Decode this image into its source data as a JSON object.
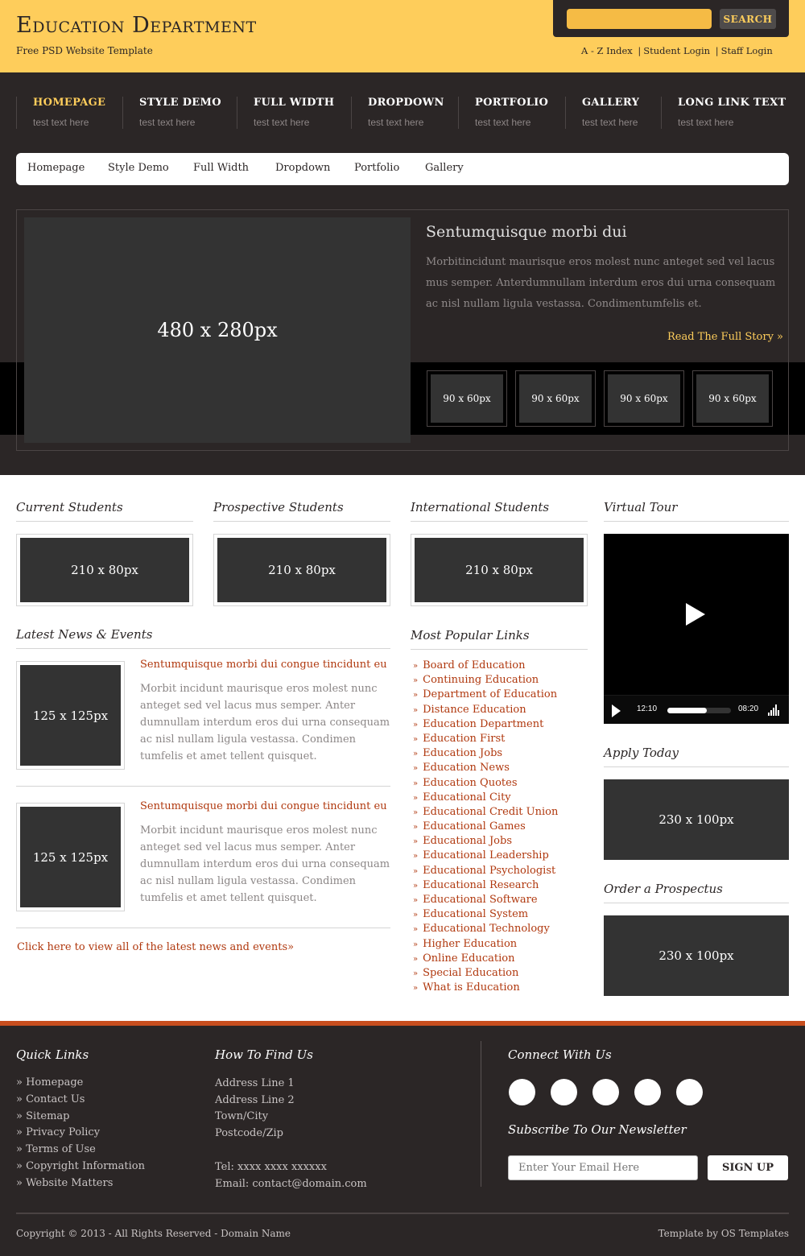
{
  "header": {
    "title": "Education Department",
    "tagline": "Free PSD Website Template",
    "search_button": "SEARCH",
    "links": [
      "A - Z Index",
      "Student Login",
      "Staff Login"
    ],
    "separator": "|"
  },
  "nav": [
    {
      "label": "HOMEPAGE",
      "sub": "test text here",
      "active": true
    },
    {
      "label": "STYLE DEMO",
      "sub": "test text here"
    },
    {
      "label": "FULL WIDTH",
      "sub": "test text here"
    },
    {
      "label": "DROPDOWN",
      "sub": "test text here"
    },
    {
      "label": "PORTFOLIO",
      "sub": "test text here"
    },
    {
      "label": "GALLERY",
      "sub": "test text here"
    },
    {
      "label": "LONG LINK TEXT",
      "sub": "test text here"
    }
  ],
  "subnav": [
    "Homepage",
    "Style Demo",
    "Full Width",
    "Dropdown",
    "Portfolio",
    "Gallery"
  ],
  "slider": {
    "main_image": "480 x 280px",
    "title": "Sentumquisque morbi dui",
    "text": "Morbitincidunt maurisque eros molest nunc anteget sed vel lacus mus semper. Anterdumnullam interdum eros dui urna consequam ac nisl nullam ligula vestassa. Condimentumfelis et.",
    "more_link": "Read The Full Story »",
    "thumbs": [
      "90 x 60px",
      "90 x 60px",
      "90 x 60px",
      "90 x 60px"
    ]
  },
  "audiences": [
    {
      "heading": "Current Students",
      "image": "210 x 80px"
    },
    {
      "heading": "Prospective Students",
      "image": "210 x 80px"
    },
    {
      "heading": "International Students",
      "image": "210 x 80px"
    }
  ],
  "news": {
    "heading": "Latest News & Events",
    "items": [
      {
        "image": "125 x 125px",
        "title": "Sentumquisque morbi dui congue tincidunt eu",
        "text": "Morbit incidunt maurisque eros molest nunc anteget sed vel lacus mus semper. Anter dumnullam interdum eros dui urna consequam ac nisl nullam ligula vestassa. Condimen tumfelis et amet tellent quisquet."
      },
      {
        "image": "125 x 125px",
        "title": "Sentumquisque morbi dui congue tincidunt eu",
        "text": "Morbit incidunt maurisque eros molest nunc anteget sed vel lacus mus semper. Anter dumnullam interdum eros dui urna consequam ac nisl nullam ligula vestassa. Condimen tumfelis et amet tellent quisquet."
      }
    ],
    "view_all": "Click here to view all of the latest news and events»"
  },
  "popular": {
    "heading": "Most Popular Links",
    "bullet": "»",
    "links": [
      "Board of Education",
      "Continuing Education",
      "Department of Education",
      "Distance Education",
      "Education Department",
      "Education First",
      "Education Jobs",
      "Education News",
      "Education Quotes",
      "Educational City",
      "Educational Credit Union",
      "Educational Games",
      "Educational Jobs",
      "Educational Leadership",
      "Educational Psychologist",
      "Educational Research",
      "Educational Software",
      "Educational System",
      "Educational Technology",
      "Higher Education",
      "Online Education",
      "Special Education",
      "What is Education"
    ]
  },
  "sidebar": {
    "tour_heading": "Virtual Tour",
    "video": {
      "elapsed": "12:10",
      "remaining": "08:20",
      "progress": 0.62
    },
    "apply_heading": "Apply Today",
    "apply_image": "230 x 100px",
    "prospectus_heading": "Order a Prospectus",
    "prospectus_image": "230 x 100px"
  },
  "footer": {
    "quick_heading": "Quick Links",
    "quick_links": [
      "» Homepage",
      "» Contact Us",
      "» Sitemap",
      "» Privacy Policy",
      "» Terms of Use",
      "» Copyright Information",
      "» Website Matters"
    ],
    "find_heading": "How To Find Us",
    "address": [
      "Address Line 1",
      "Address Line 2",
      "Town/City",
      "Postcode/Zip"
    ],
    "tel": "Tel: xxxx xxxx xxxxxx",
    "email": "Email: contact@domain.com",
    "connect_heading": "Connect With Us",
    "newsletter_heading": "Subscribe To Our Newsletter",
    "newsletter_placeholder": "Enter Your Email Here",
    "signup_button": "SIGN UP",
    "copyright": "Copyright © 2013 - All Rights Reserved - Domain Name",
    "credit": "Template by OS Templates"
  }
}
